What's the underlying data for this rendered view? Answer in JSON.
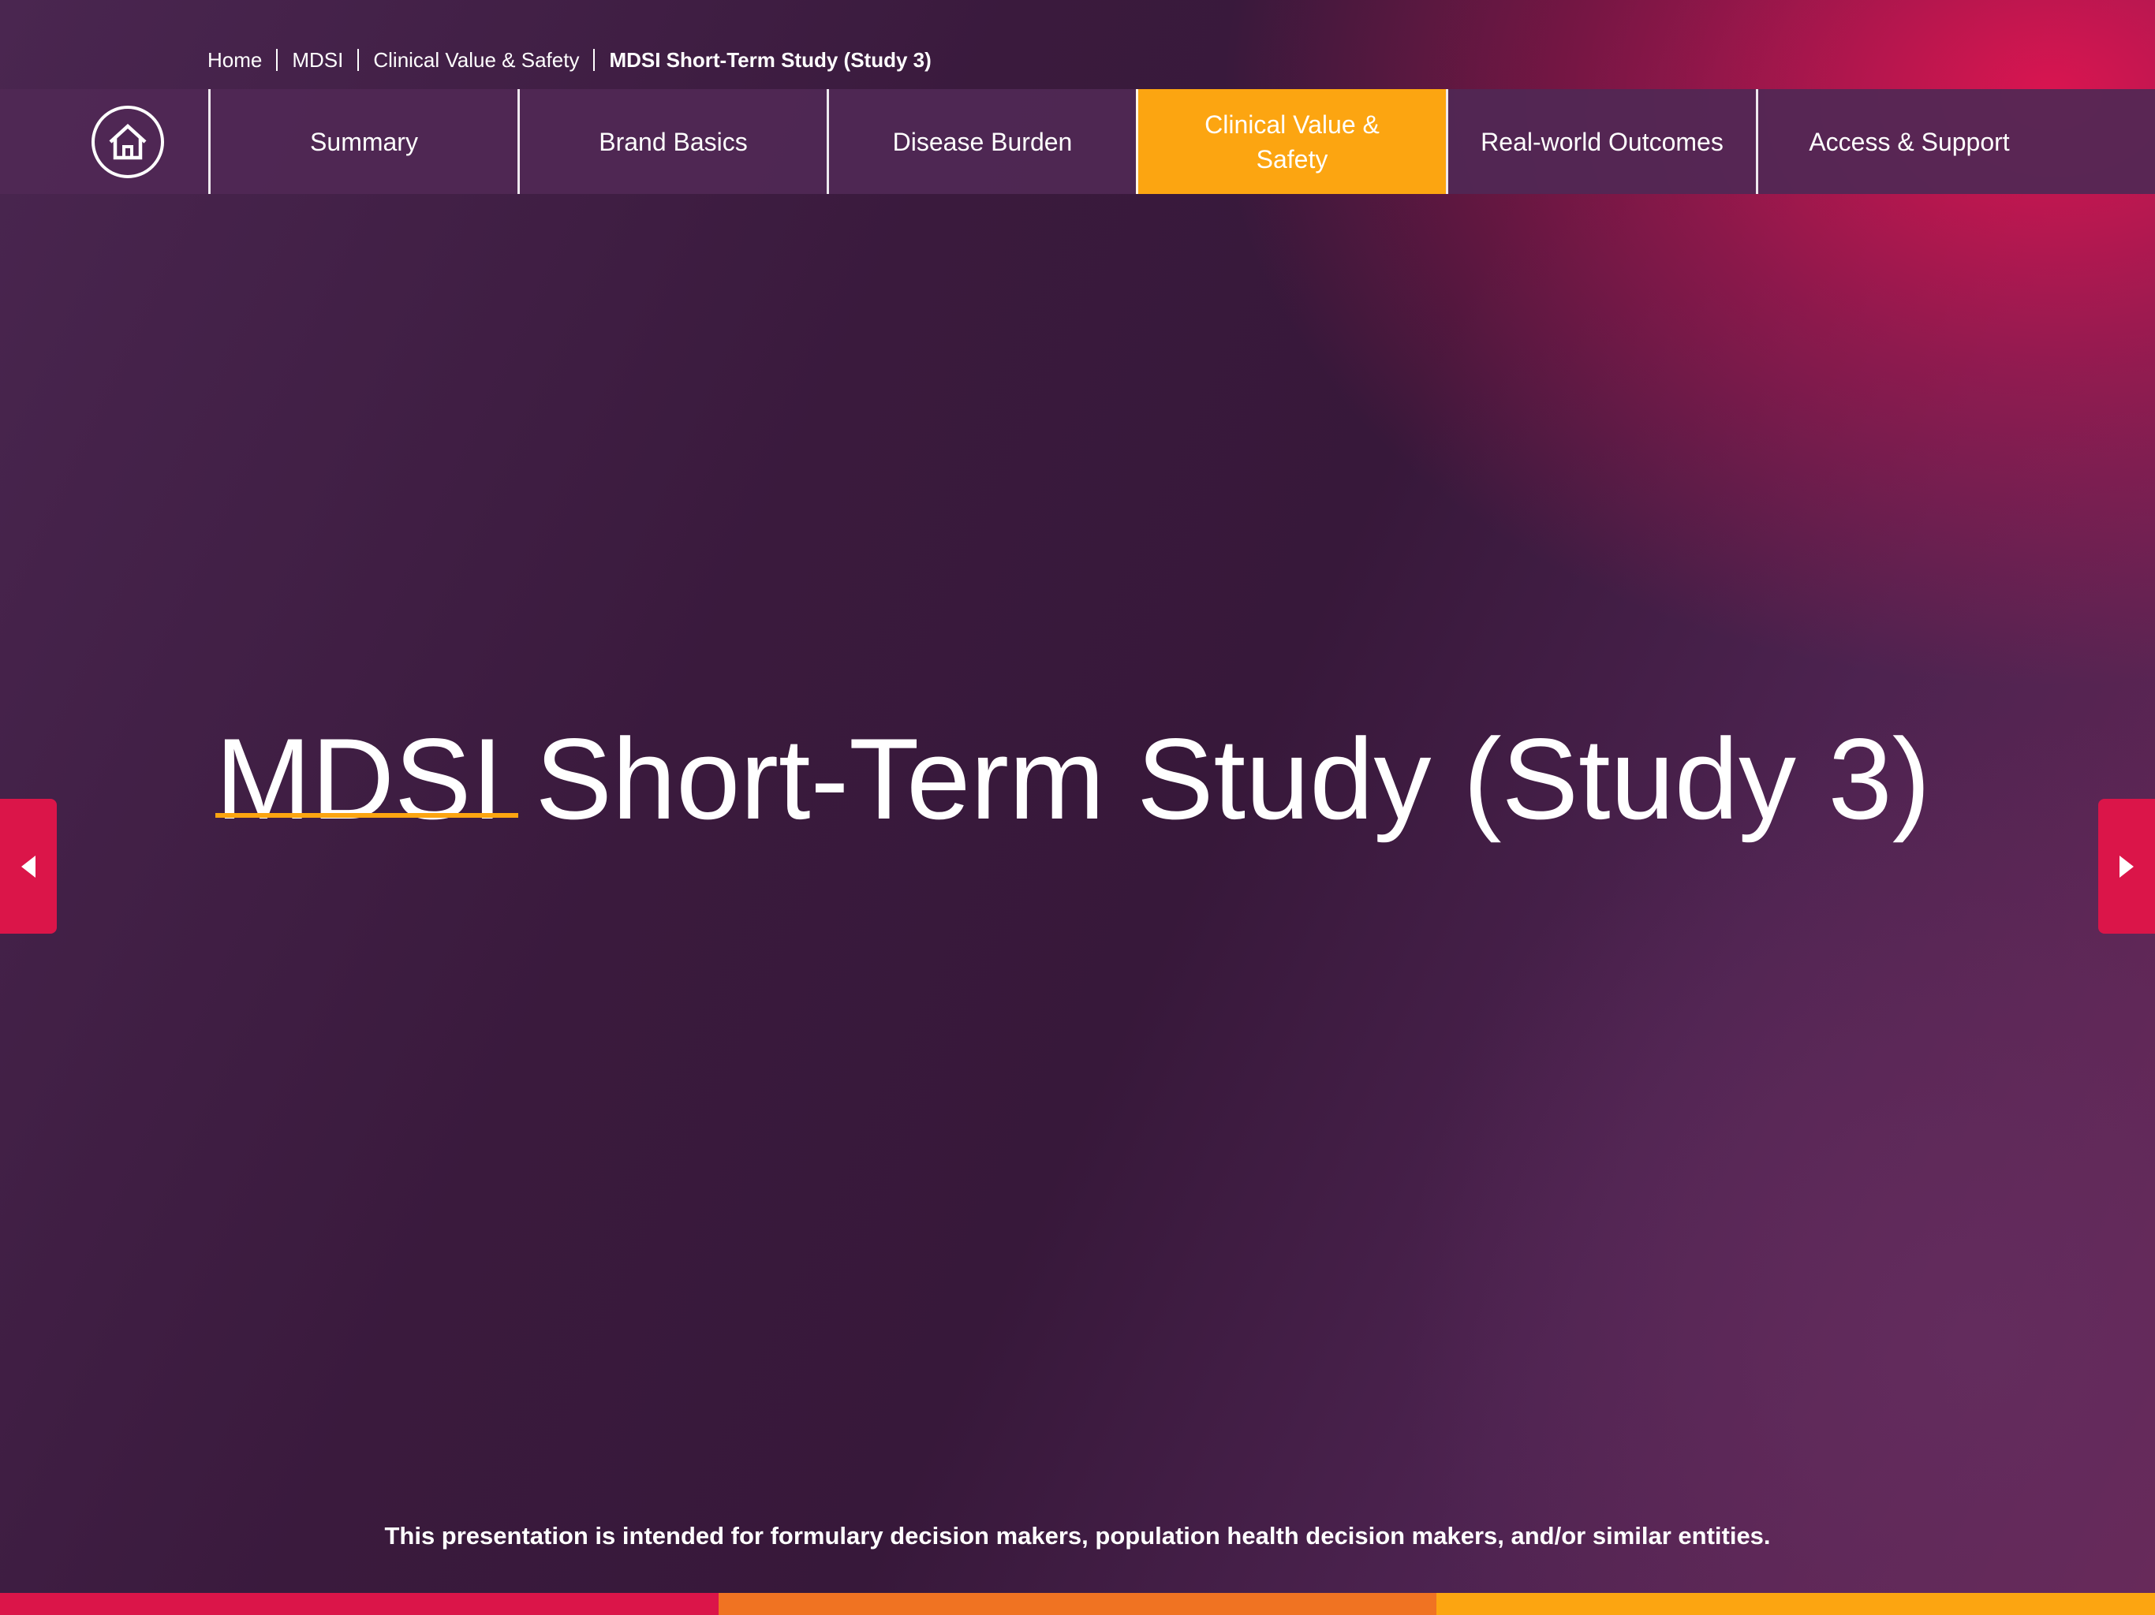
{
  "breadcrumb": {
    "items": [
      "Home",
      "MDSI",
      "Clinical Value & Safety",
      "MDSI Short-Term Study (Study 3)"
    ]
  },
  "nav": {
    "home_icon": "home-icon",
    "items": [
      {
        "label": "Summary"
      },
      {
        "label": "Brand Basics"
      },
      {
        "label": "Disease Burden"
      },
      {
        "label": "Clinical Value & Safety",
        "active": true
      },
      {
        "label": "Real-world Outcomes"
      },
      {
        "label": "Access & Support"
      }
    ]
  },
  "main": {
    "title": "MDSI Short-Term Study (Study 3)"
  },
  "controls": {
    "prev_icon": "triangle-left-icon",
    "next_icon": "triangle-right-icon"
  },
  "footer": {
    "disclaimer": "This presentation is intended for formulary decision makers, population health decision makers, and/or similar entities."
  },
  "colors": {
    "accent_orange": "#fca511",
    "accent_pink": "#db1549",
    "nav_bg": "#502855",
    "bottom_bar": [
      "#db1549",
      "#f07322",
      "#fca511"
    ]
  }
}
